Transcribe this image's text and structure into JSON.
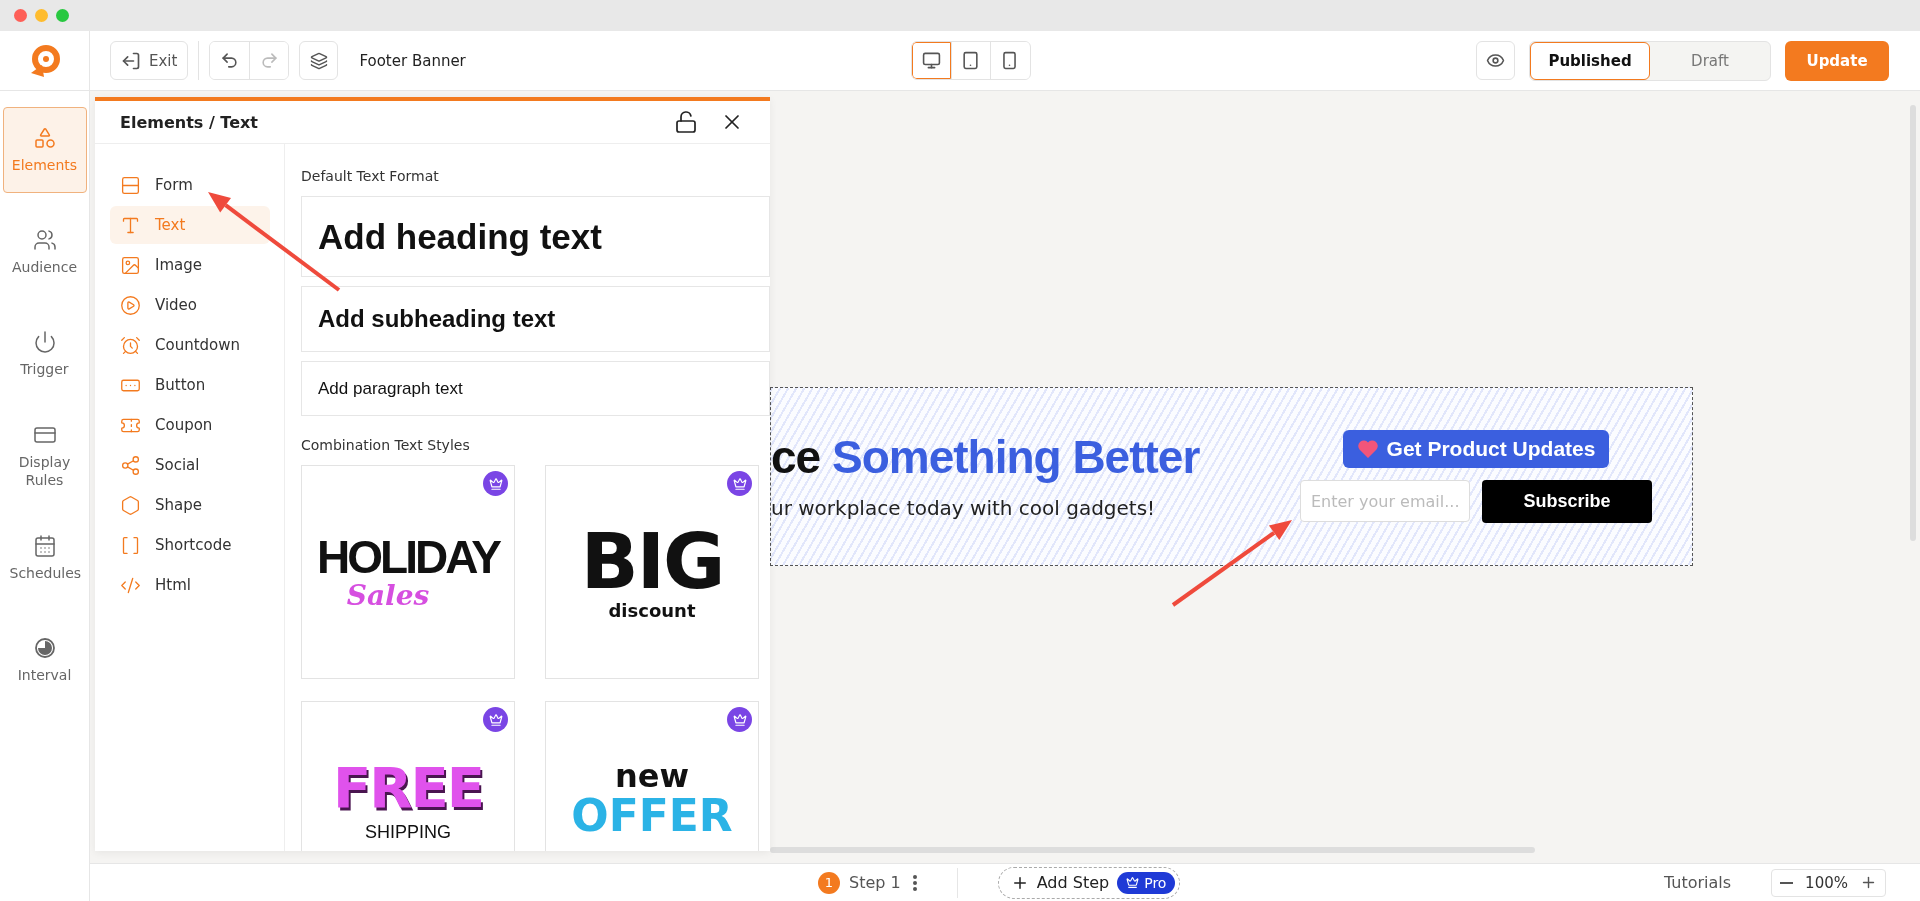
{
  "toolbar": {
    "exit": "Exit",
    "undo": {
      "disabled": false
    },
    "redo": {
      "disabled": true
    },
    "title": "Footer Banner",
    "devices": [
      {
        "selected": true
      },
      {
        "selected": false
      },
      {
        "selected": false
      }
    ],
    "status": [
      {
        "label": "Published",
        "selected": true
      },
      {
        "label": "Draft",
        "selected": false
      }
    ],
    "update": "Update"
  },
  "nav": [
    {
      "label": "Elements",
      "selected": true
    },
    {
      "label": "Audience",
      "selected": false
    },
    {
      "label": "Trigger",
      "selected": false
    },
    {
      "label": "Display Rules",
      "selected": false
    },
    {
      "label": "Schedules",
      "selected": false
    },
    {
      "label": "Interval",
      "selected": false
    }
  ],
  "panel": {
    "breadcrumb": "Elements / Text",
    "categories": [
      {
        "label": "Form",
        "selected": false
      },
      {
        "label": "Text",
        "selected": true
      },
      {
        "label": "Image",
        "selected": false
      },
      {
        "label": "Video",
        "selected": false
      },
      {
        "label": "Countdown",
        "selected": false
      },
      {
        "label": "Button",
        "selected": false
      },
      {
        "label": "Coupon",
        "selected": false
      },
      {
        "label": "Social",
        "selected": false
      },
      {
        "label": "Shape",
        "selected": false
      },
      {
        "label": "Shortcode",
        "selected": false
      },
      {
        "label": "Html",
        "selected": false
      }
    ],
    "default_heading": "Default Text Format",
    "presets": [
      {
        "kind": "heading",
        "text": "Add heading text"
      },
      {
        "kind": "subheading",
        "text": "Add subheading text"
      },
      {
        "kind": "paragraph",
        "text": "Add paragraph text"
      }
    ],
    "combo_heading": "Combination Text Styles",
    "templates": [
      {
        "kind": "holiday",
        "pro": true,
        "lines": [
          "HOLIDAY",
          "Sales"
        ]
      },
      {
        "kind": "big",
        "pro": true,
        "lines": [
          "BIG",
          "discount"
        ]
      },
      {
        "kind": "free",
        "pro": true,
        "lines": [
          "FREE",
          "SHIPPING"
        ]
      },
      {
        "kind": "offer",
        "pro": true,
        "lines": [
          "new",
          "OFFER"
        ]
      }
    ]
  },
  "banner": {
    "heading_lead": "ce",
    "heading_highlight": "Something Better",
    "subtitle": "ur workplace today with cool gadgets!",
    "badge": "Get Product Updates",
    "email_placeholder": "Enter your email...",
    "subscribe": "Subscribe"
  },
  "footer": {
    "step_number": "1",
    "step": "Step 1",
    "add_step": "Add Step",
    "pro": "Pro",
    "tutorials": "Tutorials",
    "zoom": "100%"
  }
}
